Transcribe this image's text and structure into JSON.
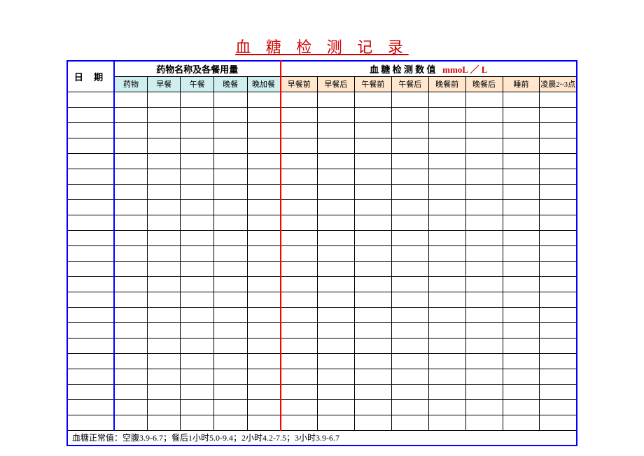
{
  "title": "血 糖 检 测 记 录",
  "header": {
    "date": "日 期",
    "medication_group": "药物名称及各餐用量",
    "blood_group_prefix": "血 糖 检 测 数 值",
    "blood_group_unit": "mmoL ／ L"
  },
  "sub_med": {
    "c1": "药物",
    "c2": "早餐",
    "c3": "午餐",
    "c4": "晚餐",
    "c5": "晚加餐"
  },
  "sub_blood": {
    "c1": "早餐前",
    "c2": "早餐后",
    "c3": "午餐前",
    "c4": "午餐后",
    "c5": "晚餐前",
    "c6": "晚餐后",
    "c7": "睡前",
    "c8": "凌晨2~3点"
  },
  "footer": "血糖正常值：空腹3.9-6.7；餐后1小时5.0-9.4；2小时4.2-7.5；3小时3.9-6.7",
  "rows": 22
}
